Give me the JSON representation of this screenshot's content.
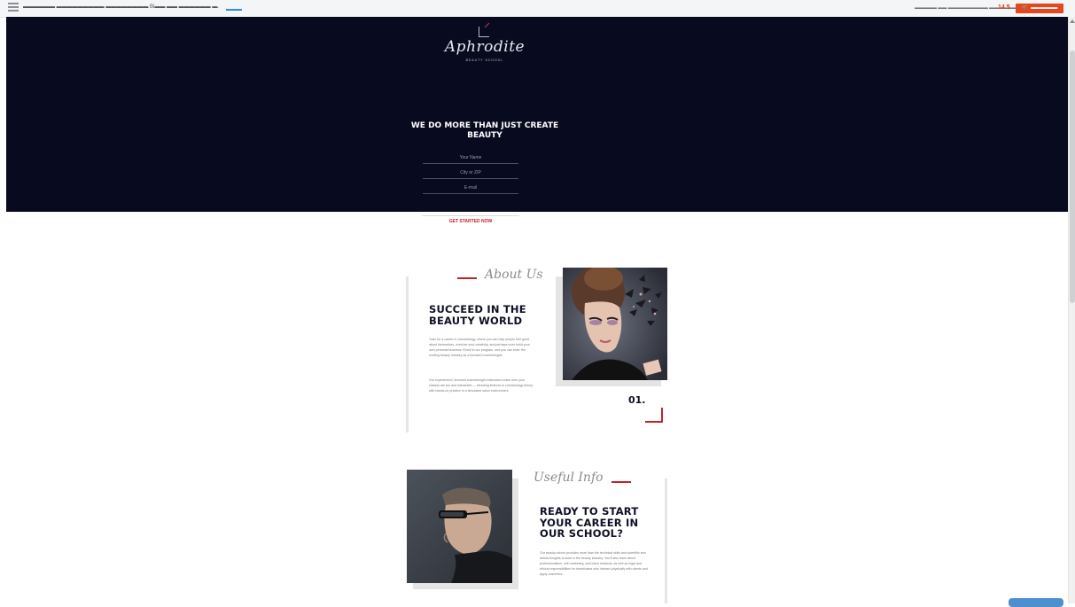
{
  "topbar": {
    "path_text": "▬▬▬▬▬▬ ▬▬▬▬▬▬▬▬▬ ▬▬▬▬▬▬▬▬ Ві▬▬ ▬▬ ▬▬▬▬▬▬ ▬.",
    "path_link": "▬▬▬",
    "right_text": "▬▬▬▬▬ ▬▬ ▬▬▬▬▬▬▬▬▬ ▬▬▬▬▬▬▬▬▬",
    "price": "14 $",
    "cart_label": "▬▬▬▬▬ ▬▬▬▬▬"
  },
  "hero": {
    "brand": "Aphrodite",
    "brand_sub": "BEAUTY SCHOOL",
    "title": "WE DO MORE THAN JUST CREATE BEAUTY",
    "fields": {
      "name_placeholder": "Your Name",
      "city_placeholder": "City or ZIP",
      "email_placeholder": "E-mail"
    },
    "cta": "GET STARTED NOW"
  },
  "about": {
    "script_label": "About Us",
    "title": "SUCCEED IN THE BEAUTY WORLD",
    "para1": "Train for a career in cosmetology, where you can help people feel good about themselves, exercise your creativity, and perhaps even build your own personal business. Enroll in our program, and you can enter the exciting beauty industry as a licensed cosmetologist.",
    "para2": "Our experienced, licensed cosmetologist instructors make sure your classes are fun and interactive — blending lectures in cosmetology theory with hands-on practice in a simulated salon environment.",
    "number": "01."
  },
  "useful": {
    "script_label": "Useful Info",
    "title": "READY TO START YOUR CAREER IN OUR SCHOOL?",
    "para": "Our beauty school provides more than the technical skills and scientific and artistic insights to work in the beauty industry. You'll also learn about professionalism, self-marketing, and client relations, as well as legal and ethical responsibilities for beauticians who interact physically with clients and apply cosmetics."
  }
}
